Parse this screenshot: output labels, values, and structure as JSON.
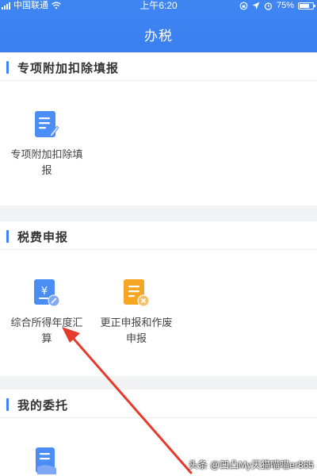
{
  "status_bar": {
    "carrier": "中国联通",
    "time": "上午6:20",
    "battery": "75%",
    "battery_level": 0.75
  },
  "nav": {
    "title": "办税"
  },
  "sections": [
    {
      "title": "专项附加扣除填报",
      "items": [
        {
          "label": "专项附加扣除填报",
          "icon": "document-edit-icon",
          "color": "#4a8ef5"
        }
      ]
    },
    {
      "title": "税费申报",
      "items": [
        {
          "label": "综合所得年度汇算",
          "icon": "tax-document-yuan-icon",
          "color": "#4a8ef5"
        },
        {
          "label": "更正申报和作废申报",
          "icon": "void-document-icon",
          "color": "#f5a623"
        }
      ]
    },
    {
      "title": "我的委托",
      "items": [
        {
          "label": "",
          "icon": "delegation-document-icon",
          "color": "#4a8ef5"
        }
      ]
    }
  ],
  "watermark": {
    "text": "头条 @凹凸My天猫喵喵er865"
  },
  "colors": {
    "accent": "#3f86f2",
    "annotation_arrow": "#e53b2c"
  }
}
